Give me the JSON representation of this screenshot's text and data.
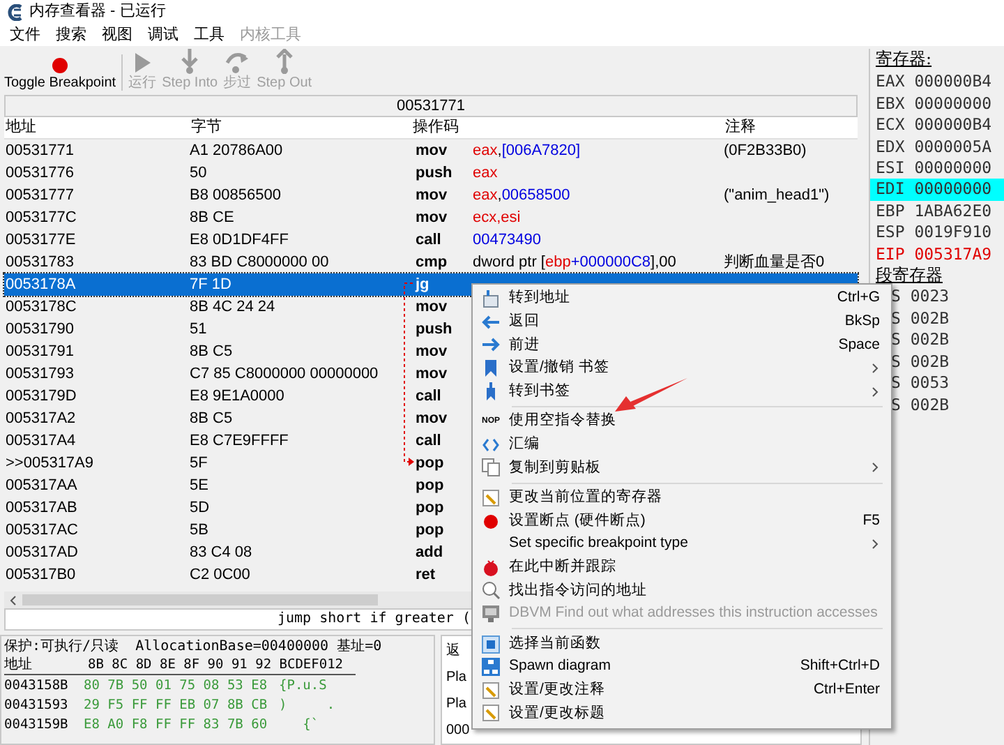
{
  "window": {
    "title": "内存查看器 - 已运行"
  },
  "menu_bar": [
    {
      "label": "文件",
      "disabled": false
    },
    {
      "label": "搜索",
      "disabled": false
    },
    {
      "label": "视图",
      "disabled": false
    },
    {
      "label": "调试",
      "disabled": false
    },
    {
      "label": "工具",
      "disabled": false
    },
    {
      "label": "内核工具",
      "disabled": true
    }
  ],
  "toolbar": [
    {
      "label": "Toggle Breakpoint",
      "disabled": false
    },
    {
      "label": "运行",
      "disabled": true
    },
    {
      "label": "Step Into",
      "disabled": true
    },
    {
      "label": "步过",
      "disabled": true
    },
    {
      "label": "Step Out",
      "disabled": true
    }
  ],
  "address_bar": "00531771",
  "disassembly": {
    "columns": [
      "地址",
      "字节",
      "操作码",
      "注释"
    ],
    "rows": [
      {
        "address": "00531771",
        "bytes": "A1 20786A00",
        "opcode": "mov",
        "operands": [
          {
            "kind": "register",
            "text": "eax"
          },
          {
            "kind": "plain",
            "text": ","
          },
          {
            "kind": "number",
            "text": "[006A7820]"
          }
        ],
        "comment": "(0F2B33B0)",
        "selected": false
      },
      {
        "address": "00531776",
        "bytes": "50",
        "opcode": "push",
        "operands": [
          {
            "kind": "register",
            "text": "eax"
          }
        ],
        "selected": false
      },
      {
        "address": "00531777",
        "bytes": "B8 00856500",
        "opcode": "mov",
        "operands": [
          {
            "kind": "register",
            "text": "eax"
          },
          {
            "kind": "plain",
            "text": ","
          },
          {
            "kind": "number",
            "text": "00658500"
          }
        ],
        "comment": "(\"anim_head1\")",
        "selected": false
      },
      {
        "address": "0053177C",
        "bytes": "8B CE",
        "opcode": "mov",
        "operands": [
          {
            "kind": "register",
            "text": "ecx,esi"
          }
        ],
        "selected": false
      },
      {
        "address": "0053177E",
        "bytes": "E8 0D1DF4FF",
        "opcode": "call",
        "operands": [
          {
            "kind": "number",
            "text": "00473490"
          }
        ],
        "selected": false
      },
      {
        "address": "00531783",
        "bytes": "83 BD C8000000 00",
        "opcode": "cmp",
        "operands": [
          {
            "kind": "plain",
            "text": "dword ptr ["
          },
          {
            "kind": "register",
            "text": "ebp"
          },
          {
            "kind": "number",
            "text": "+000000C8"
          },
          {
            "kind": "plain",
            "text": "],00"
          }
        ],
        "comment": "判断血量是否0",
        "selected": false
      },
      {
        "address": "0053178A",
        "bytes": "7F 1D",
        "opcode": "jg",
        "selected": true
      },
      {
        "address": "0053178C",
        "bytes": "8B 4C 24 24",
        "opcode": "mov",
        "selected": false
      },
      {
        "address": "00531790",
        "bytes": "51",
        "opcode": "push",
        "selected": false
      },
      {
        "address": "00531791",
        "bytes": "8B C5",
        "opcode": "mov",
        "selected": false
      },
      {
        "address": "00531793",
        "bytes": "C7 85 C8000000 00000000",
        "opcode": "mov",
        "selected": false
      },
      {
        "address": "0053179D",
        "bytes": "E8 9E1A0000",
        "opcode": "call",
        "selected": false
      },
      {
        "address": "005317A2",
        "bytes": "8B C5",
        "opcode": "mov",
        "selected": false
      },
      {
        "address": "005317A4",
        "bytes": "E8 C7E9FFFF",
        "opcode": "call",
        "selected": false
      },
      {
        "address": ">>005317A9",
        "bytes": "5F",
        "opcode": "pop",
        "selected": false
      },
      {
        "address": "005317AA",
        "bytes": "5E",
        "opcode": "pop",
        "selected": false
      },
      {
        "address": "005317AB",
        "bytes": "5D",
        "opcode": "pop",
        "selected": false
      },
      {
        "address": "005317AC",
        "bytes": "5B",
        "opcode": "pop",
        "selected": false
      },
      {
        "address": "005317AD",
        "bytes": "83 C4 08",
        "opcode": "add",
        "selected": false
      },
      {
        "address": "005317B0",
        "bytes": "C2 0C00",
        "opcode": "ret",
        "selected": false
      }
    ]
  },
  "status_line": "jump short if greater (",
  "hex_view": {
    "info": "保护:可执行/只读  AllocationBase=00400000 基址=0",
    "header_address": "地址",
    "header_bytes": "8B 8C 8D 8E 8F 90 91 92 BCDEF012",
    "rows": [
      {
        "address": "0043158B",
        "bytes": "80 7B 50 01 75 08 53 E8",
        "ascii": "{P.u.S"
      },
      {
        "address": "00431593",
        "bytes": "29 F5 FF FF EB 07 8B CB",
        "ascii": ")     ."
      },
      {
        "address": "0043159B",
        "bytes": "E8 A0 F8 FF FF 83 7B 60",
        "ascii": "   {`"
      }
    ]
  },
  "side_panel": [
    "返",
    "Pla",
    "Pla",
    "000"
  ],
  "registers": {
    "title": "寄存器:",
    "items": [
      {
        "text": "EAX 000000B4",
        "highlighted": false,
        "changed": false
      },
      {
        "text": "EBX 00000000",
        "highlighted": false,
        "changed": false
      },
      {
        "text": "ECX 000000B4",
        "highlighted": false,
        "changed": false
      },
      {
        "text": "EDX 0000005A",
        "highlighted": false,
        "changed": false
      },
      {
        "text": "ESI 00000000",
        "highlighted": false,
        "changed": false
      },
      {
        "text": "EDI 00000000",
        "highlighted": true,
        "changed": false
      },
      {
        "text": "EBP 1ABA62E0",
        "highlighted": false,
        "changed": false
      },
      {
        "text": "ESP 0019F910",
        "highlighted": false,
        "changed": false
      },
      {
        "text": "EIP 005317A9",
        "highlighted": false,
        "changed": true
      }
    ],
    "segment_title": "段寄存器",
    "segments": [
      "S 0023",
      "S 002B",
      "S 002B",
      "S 002B",
      "S 0053",
      "S 002B"
    ]
  },
  "context_menu": [
    {
      "kind": "item",
      "label": "转到地址",
      "shortcut": "Ctrl+G",
      "submenu": false,
      "disabled": false
    },
    {
      "kind": "item",
      "label": "返回",
      "shortcut": "BkSp",
      "submenu": false,
      "disabled": false
    },
    {
      "kind": "item",
      "label": "前进",
      "shortcut": "Space",
      "submenu": false,
      "disabled": false
    },
    {
      "kind": "item",
      "label": "设置/撤销 书签",
      "submenu": true,
      "disabled": false
    },
    {
      "kind": "item",
      "label": "转到书签",
      "submenu": true,
      "disabled": false
    },
    {
      "kind": "separator"
    },
    {
      "kind": "item",
      "label": "使用空指令替换",
      "icon_text": "NOP",
      "submenu": false,
      "disabled": false
    },
    {
      "kind": "item",
      "label": "汇编",
      "submenu": false,
      "disabled": false
    },
    {
      "kind": "item",
      "label": "复制到剪贴板",
      "submenu": true,
      "disabled": false
    },
    {
      "kind": "separator"
    },
    {
      "kind": "item",
      "label": "更改当前位置的寄存器",
      "submenu": false,
      "disabled": false
    },
    {
      "kind": "item",
      "label": "设置断点 (硬件断点)",
      "shortcut": "F5",
      "submenu": false,
      "disabled": false
    },
    {
      "kind": "item",
      "label": "Set specific breakpoint type",
      "submenu": true,
      "disabled": false
    },
    {
      "kind": "item",
      "label": "在此中断并跟踪",
      "submenu": false,
      "disabled": false
    },
    {
      "kind": "item",
      "label": "找出指令访问的地址",
      "submenu": false,
      "disabled": false
    },
    {
      "kind": "item",
      "label": "DBVM Find out what addresses this instruction accesses",
      "submenu": false,
      "disabled": true
    },
    {
      "kind": "separator"
    },
    {
      "kind": "item",
      "label": "选择当前函数",
      "submenu": false,
      "disabled": false
    },
    {
      "kind": "item",
      "label": "Spawn diagram",
      "shortcut": "Shift+Ctrl+D",
      "submenu": false,
      "disabled": false
    },
    {
      "kind": "item",
      "label": "设置/更改注释",
      "shortcut": "Ctrl+Enter",
      "submenu": false,
      "disabled": false
    },
    {
      "kind": "item",
      "label": "设置/更改标题",
      "submenu": false,
      "disabled": false
    }
  ]
}
